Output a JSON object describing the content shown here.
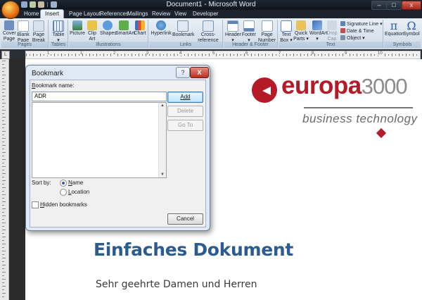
{
  "window": {
    "title": "Document1 - Microsoft Word",
    "min": "–",
    "max": "□",
    "close": "x"
  },
  "tabs": [
    "Home",
    "Insert",
    "Page Layout",
    "References",
    "Mailings",
    "Review",
    "View",
    "Developer"
  ],
  "active_tab": "Insert",
  "ribbon": {
    "groups": {
      "pages": "Pages",
      "tables": "Tables",
      "illustrations": "Illustrations",
      "links": "Links",
      "header_footer": "Header & Footer",
      "text": "Text",
      "symbols": "Symbols"
    },
    "pages": {
      "cover": "Cover\nPage ▾",
      "blank": "Blank\nPage",
      "break": "Page\nBreak"
    },
    "tables": {
      "table": "Table\n▾"
    },
    "illustrations": {
      "picture": "Picture",
      "clipart": "Clip\nArt",
      "shapes": "Shapes",
      "smartart": "SmartArt",
      "chart": "Chart"
    },
    "links": {
      "hyperlink": "Hyperlink",
      "bookmark": "Bookmark",
      "crossref": "Cross-reference"
    },
    "header_footer": {
      "header": "Header\n▾",
      "footer": "Footer\n▾",
      "pagenumber": "Page\nNumber ▾"
    },
    "text": {
      "textbox": "Text\nBox ▾",
      "quickparts": "Quick\nParts ▾",
      "wordart": "WordArt\n▾",
      "dropcap": "Drop\nCap ▾",
      "sigline": "Signature Line ▾",
      "datetime": "Date & Time",
      "object": "Object ▾"
    },
    "symbols": {
      "equation": "Equation",
      "symbol": "Symbol",
      "equation_glyph": "π",
      "symbol_glyph": "Ω"
    }
  },
  "ruler": {
    "corner": "L",
    "numbers": [
      "1",
      "1",
      "2",
      "3",
      "4",
      "5",
      "6",
      "7",
      "8",
      "9",
      "10"
    ]
  },
  "dialog": {
    "title": "Bookmark",
    "help": "?",
    "close": "X",
    "name_label_u": "B",
    "name_label_rest": "ookmark name:",
    "name_value": "ADR",
    "add": "Add",
    "delete": "Delete",
    "goto": "Go To",
    "sortby": "Sort by:",
    "sort_name_u": "N",
    "sort_name_rest": "ame",
    "sort_location_u": "L",
    "sort_location_rest": "ocation",
    "hidden_u": "H",
    "hidden_rest": "idden bookmarks",
    "cancel": "Cancel",
    "sort_selected": "Name"
  },
  "logo": {
    "brand_bold": "europa",
    "brand_light": "3000",
    "tagline": "business technology",
    "color": "#b51a28"
  },
  "document": {
    "title": "Einfaches Dokument",
    "greeting": "Sehr geehrte Damen und Herren"
  }
}
